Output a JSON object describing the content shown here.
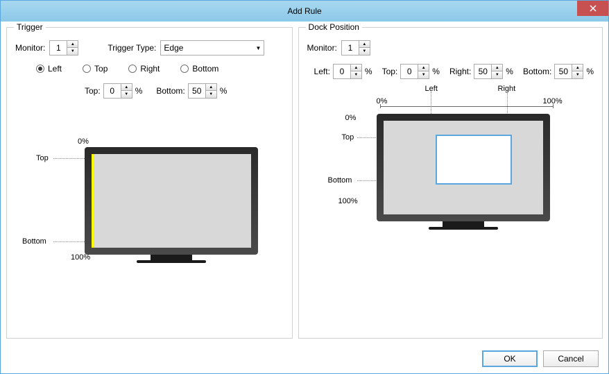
{
  "window": {
    "title": "Add Rule"
  },
  "trigger": {
    "group_title": "Trigger",
    "monitor_label": "Monitor:",
    "monitor_value": "1",
    "type_label": "Trigger Type:",
    "type_value": "Edge",
    "edge_left": "Left",
    "edge_top": "Top",
    "edge_right": "Right",
    "edge_bottom": "Bottom",
    "top_label": "Top:",
    "top_value": "0",
    "bottom_label": "Bottom:",
    "bottom_value": "50",
    "percent": "%",
    "viz_zero": "0%",
    "viz_hundred": "100%",
    "viz_top": "Top",
    "viz_bottom": "Bottom"
  },
  "dock": {
    "group_title": "Dock Position",
    "monitor_label": "Monitor:",
    "monitor_value": "1",
    "left_label": "Left:",
    "left_value": "0",
    "top_label": "Top:",
    "top_value": "0",
    "right_label": "Right:",
    "right_value": "50",
    "bottom_label": "Bottom:",
    "bottom_value": "50",
    "percent": "%",
    "viz_zero": "0%",
    "viz_hundred": "100%",
    "viz_left": "Left",
    "viz_right": "Right",
    "viz_top": "Top",
    "viz_bottom": "Bottom"
  },
  "buttons": {
    "ok": "OK",
    "cancel": "Cancel"
  }
}
